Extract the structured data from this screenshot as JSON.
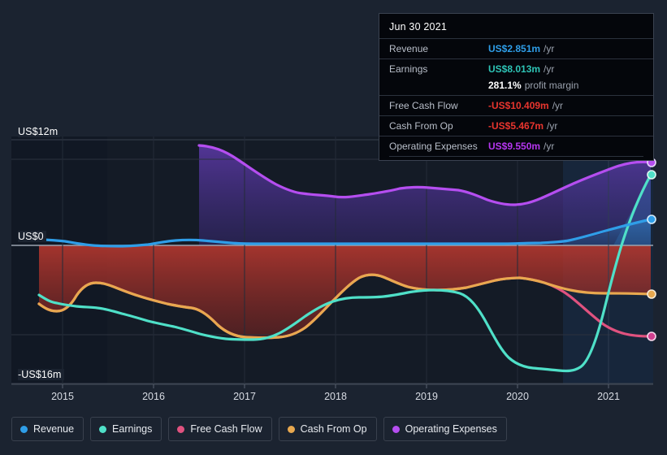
{
  "tooltip": {
    "title": "Jun 30 2021",
    "rows": [
      {
        "key": "Revenue",
        "value": "US$2.851m",
        "unit": "/yr",
        "color": "#2f9ee8"
      },
      {
        "key": "Earnings",
        "value": "US$8.013m",
        "unit": "/yr",
        "color": "#2ec4b6"
      },
      {
        "key": "Free Cash Flow",
        "value": "-US$10.409m",
        "unit": "/yr",
        "color": "#e8352e"
      },
      {
        "key": "Cash From Op",
        "value": "-US$5.467m",
        "unit": "/yr",
        "color": "#e8352e"
      },
      {
        "key": "Operating Expenses",
        "value": "US$9.550m",
        "unit": "/yr",
        "color": "#b536f0"
      }
    ],
    "margin": {
      "value": "281.1%",
      "label": "profit margin"
    }
  },
  "legend": [
    {
      "label": "Revenue",
      "color": "#2f9ee8"
    },
    {
      "label": "Earnings",
      "color": "#4fe0c8"
    },
    {
      "label": "Free Cash Flow",
      "color": "#e0527f"
    },
    {
      "label": "Cash From Op",
      "color": "#e8a košice"
    },
    {
      "label": "Operating Expenses",
      "color": "#b54ef0"
    }
  ],
  "axis": {
    "y_labels": {
      "top": "US$12m",
      "zero": "US$0",
      "bottom": "-US$16m"
    },
    "x_labels": [
      "2015",
      "2016",
      "2017",
      "2018",
      "2019",
      "2020",
      "2021"
    ]
  },
  "chart_data": {
    "type": "line",
    "title": "",
    "xlabel": "",
    "ylabel": "US$",
    "ylim": [
      -16,
      12
    ],
    "grid": true,
    "legend_position": "bottom",
    "x": [
      "2014.7",
      "2015.0",
      "2015.25",
      "2015.5",
      "2015.75",
      "2016.0",
      "2016.25",
      "2016.5",
      "2016.75",
      "2017.0",
      "2017.25",
      "2017.5",
      "2017.75",
      "2018.0",
      "2018.25",
      "2018.5",
      "2018.75",
      "2019.0",
      "2019.25",
      "2019.5",
      "2019.75",
      "2020.0",
      "2020.25",
      "2020.5",
      "2020.75",
      "2021.0",
      "2021.25",
      "2021.5"
    ],
    "series": [
      {
        "name": "Revenue",
        "color": "#2f9ee8",
        "values": [
          0.35,
          0.3,
          0.1,
          -0.05,
          -0.1,
          -0.12,
          -0.05,
          0.1,
          0.25,
          0.35,
          0.3,
          0.2,
          0.12,
          0.08,
          0.05,
          0.05,
          0.05,
          0.05,
          0.05,
          0.05,
          0.05,
          0.05,
          0.08,
          0.15,
          0.35,
          0.8,
          1.8,
          2.851
        ]
      },
      {
        "name": "Earnings",
        "color": "#4fe0c8",
        "values": [
          -6.7,
          -7.1,
          -7.8,
          -7.9,
          -8.2,
          -8.6,
          -9.4,
          -10.3,
          -10.6,
          -10.7,
          -10.4,
          -9.9,
          -9.2,
          -8.4,
          -8.0,
          -7.9,
          -7.7,
          -7.5,
          -7.4,
          -7.4,
          -9.0,
          -12.5,
          -13.2,
          -13.5,
          -13.6,
          -9.5,
          -2.0,
          8.013
        ]
      },
      {
        "name": "Free Cash Flow",
        "color": "#e0527f",
        "values": [
          -7.6,
          -8.5,
          -8.7,
          -6.7,
          -6.5,
          -6.8,
          -7.3,
          -7.7,
          -8.2,
          -8.6,
          -9.7,
          -10.4,
          -10.5,
          -10.4,
          -9.6,
          -8.2,
          -7.2,
          -6.9,
          -7.1,
          -6.9,
          -6.8,
          -6.3,
          -6.1,
          -6.3,
          -7.2,
          -8.4,
          -9.5,
          -10.409
        ]
      },
      {
        "name": "Cash From Op",
        "color": "#e8a köz",
        "values": [
          -7.6,
          -8.5,
          -8.7,
          -6.7,
          -6.5,
          -6.8,
          -7.3,
          -7.7,
          -8.2,
          -8.6,
          -9.7,
          -10.4,
          -10.5,
          -10.4,
          -9.6,
          -8.2,
          -7.2,
          -6.9,
          -7.1,
          -6.9,
          -6.8,
          -6.3,
          -6.1,
          -6.3,
          -6.5,
          -6.1,
          -5.8,
          -5.467
        ]
      },
      {
        "name": "Operating Expenses",
        "color": "#b54ef0",
        "values": [
          null,
          null,
          null,
          null,
          null,
          null,
          null,
          11.6,
          11.4,
          10.2,
          8.9,
          7.7,
          7.0,
          6.9,
          6.6,
          7.0,
          7.0,
          6.9,
          6.9,
          6.6,
          5.9,
          5.6,
          5.8,
          6.4,
          7.0,
          7.6,
          8.6,
          9.55
        ]
      }
    ]
  }
}
